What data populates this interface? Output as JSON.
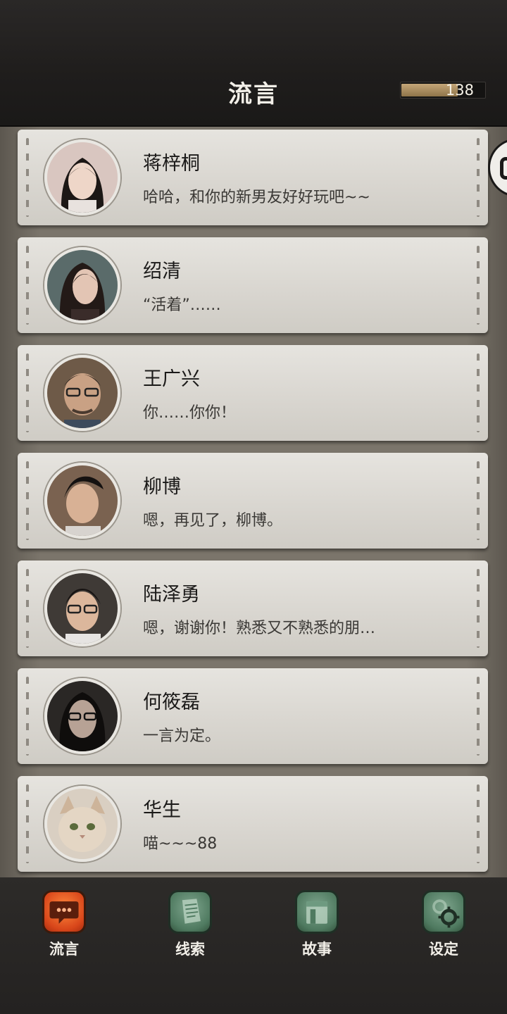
{
  "header": {
    "title": "流言",
    "counter_value": "138",
    "counter_fill_fraction": 0.68
  },
  "contacts": [
    {
      "name": "蒋梓桐",
      "message": "哈哈，和你的新男友好好玩吧~~",
      "avatar_icon": "woman-portrait-icon"
    },
    {
      "name": "绍清",
      "message": "“活着”……",
      "avatar_icon": "woman-portrait-icon"
    },
    {
      "name": "王广兴",
      "message": "你……你你！",
      "avatar_icon": "man-glasses-portrait-icon"
    },
    {
      "name": "柳博",
      "message": "嗯，再见了，柳博。",
      "avatar_icon": "man-portrait-icon"
    },
    {
      "name": "陆泽勇",
      "message": "嗯，谢谢你！熟悉又不熟悉的朋…",
      "avatar_icon": "man-glasses-portrait-icon"
    },
    {
      "name": "何筱磊",
      "message": "一言为定。",
      "avatar_icon": "man-glasses-portrait-icon"
    },
    {
      "name": "华生",
      "message": "喵~~~88",
      "avatar_icon": "cat-portrait-icon"
    }
  ],
  "nav": {
    "items": [
      {
        "label": "流言",
        "icon": "chat-bubble-icon",
        "active": true
      },
      {
        "label": "线索",
        "icon": "document-icon",
        "active": false
      },
      {
        "label": "故事",
        "icon": "book-icon",
        "active": false
      },
      {
        "label": "设定",
        "icon": "gear-icon",
        "active": false
      }
    ]
  },
  "colors": {
    "active_tab": "#d8461a",
    "inactive_tab": "#4f7a60",
    "counter_fill": "#b0946a"
  }
}
